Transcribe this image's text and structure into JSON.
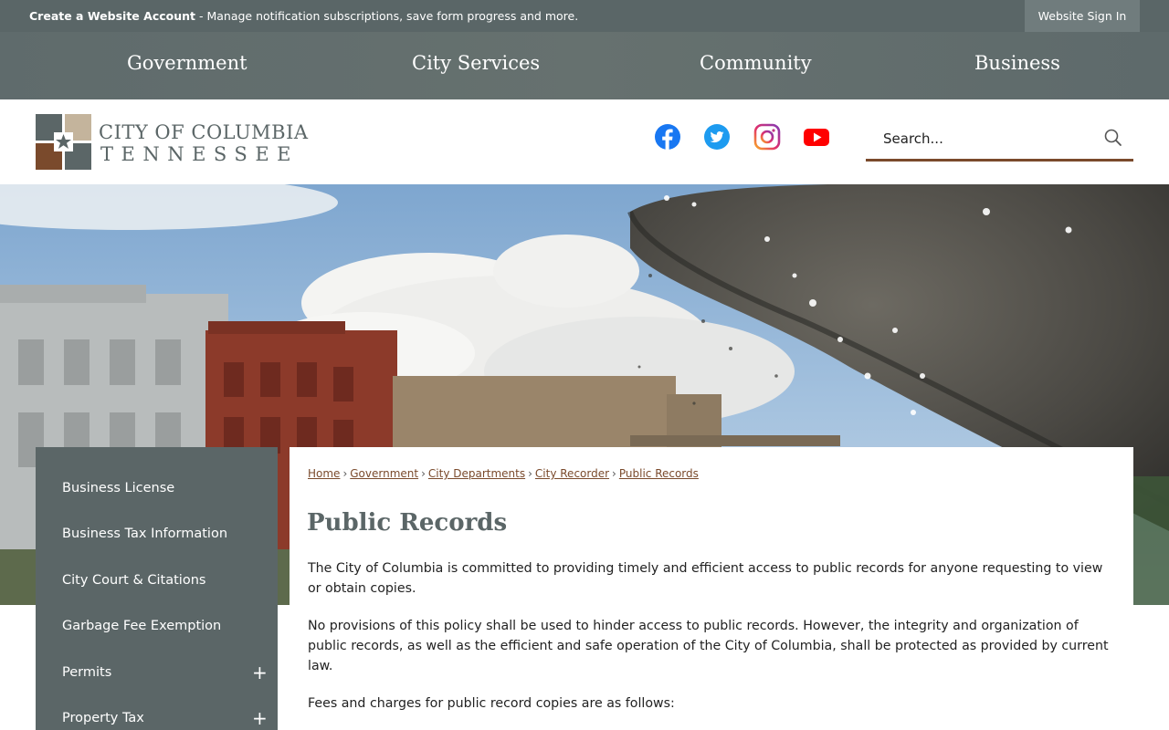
{
  "topbar": {
    "create_account": "Create a Website Account",
    "message": " - Manage notification subscriptions, save form progress and more.",
    "sign_in": "Website Sign In"
  },
  "nav": {
    "items": [
      "Government",
      "City Services",
      "Community",
      "Business"
    ]
  },
  "logo": {
    "line1": "CITY OF COLUMBIA",
    "line2": "TENNESSEE",
    "colors": [
      "#5b6667",
      "#c4b49c",
      "#7a4a2c"
    ]
  },
  "social": [
    {
      "name": "facebook-icon",
      "color": "#1877f2"
    },
    {
      "name": "twitter-icon",
      "color": "#1d9bf0"
    },
    {
      "name": "instagram-icon",
      "color": "#d6249f"
    },
    {
      "name": "youtube-icon",
      "color": "#ff0000"
    }
  ],
  "search": {
    "placeholder": "Search..."
  },
  "sidemenu": {
    "items": [
      {
        "label": "Business License"
      },
      {
        "label": "Business Tax Information"
      },
      {
        "label": "City Court & Citations"
      },
      {
        "label": "Garbage Fee Exemption"
      },
      {
        "label": "Permits"
      },
      {
        "label": "Property Tax"
      }
    ],
    "expand_symbol": "+"
  },
  "breadcrumb": {
    "items": [
      "Home",
      "Government",
      "City Departments",
      "City Recorder",
      "Public Records"
    ],
    "separator": "›"
  },
  "page": {
    "title": "Public Records",
    "paragraphs": [
      "The City of Columbia is committed to providing timely and efficient access to public records for anyone requesting to view or obtain copies.",
      "No provisions of this policy shall be used to hinder access to public records. However, the integrity and organization of public records, as well as the efficient and safe operation of the City of Columbia, shall be protected as provided by current law.",
      "Fees and charges for public record copies are as follows:"
    ]
  },
  "colors": {
    "slate": "#5b6667",
    "brown_accent": "#7a4a2c"
  }
}
